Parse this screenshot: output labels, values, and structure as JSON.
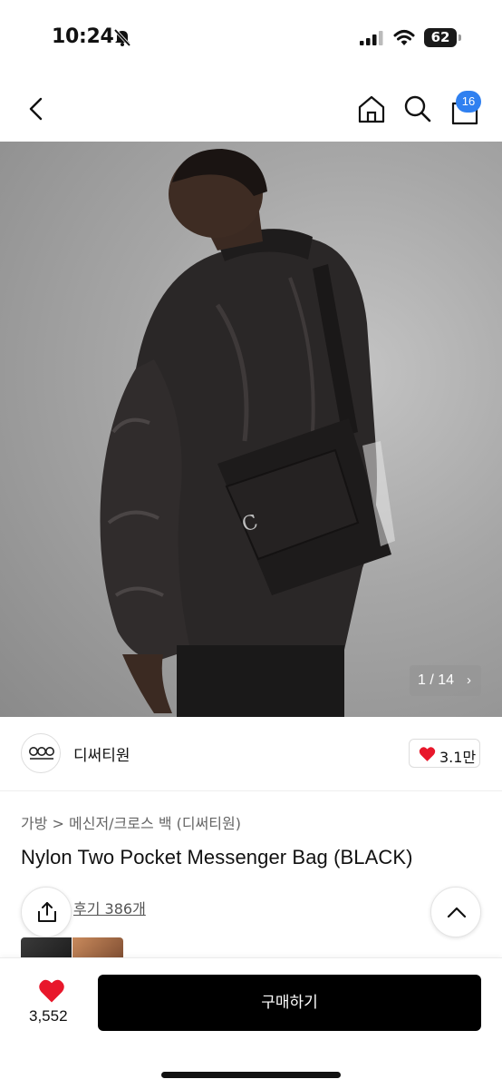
{
  "status_bar": {
    "time": "10:24",
    "battery": "62"
  },
  "nav": {
    "cart_badge": "16"
  },
  "gallery": {
    "counter": "1 / 14",
    "counter_chevron": "›",
    "current_index": 1,
    "total": 14
  },
  "brand": {
    "name": "디써티원",
    "likes": "3.1만"
  },
  "product": {
    "breadcrumb": "가방 > 메신저/크로스 백 (디써티원)",
    "title": "Nylon Two Pocket Messenger Bag (BLACK)",
    "review_link": "후기 386개"
  },
  "bottom_bar": {
    "wish_count": "3,552",
    "buy_label": "구매하기"
  },
  "colors": {
    "accent_blue": "#2f80f0",
    "heart_red": "#e8172b",
    "buy_button": "#000000"
  }
}
